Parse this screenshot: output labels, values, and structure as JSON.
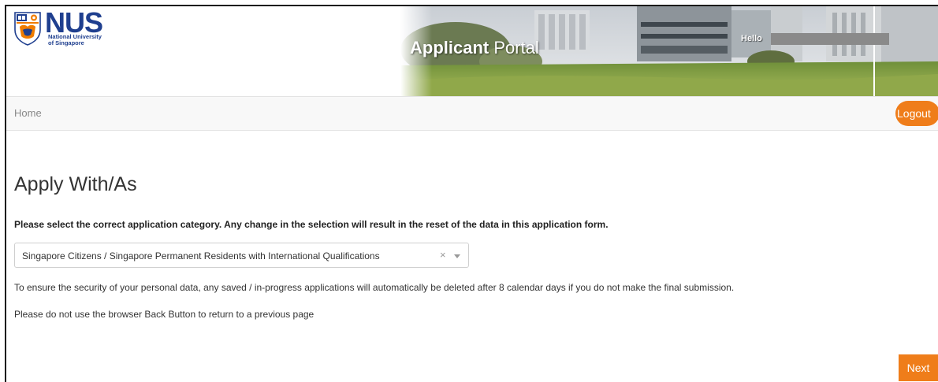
{
  "header": {
    "logo": {
      "name": "NUS",
      "subtitle": "National University\nof Singapore"
    },
    "portal_title_bold": "Applicant",
    "portal_title_light": " Portal",
    "greeting": "Hello"
  },
  "navbar": {
    "home_label": "Home",
    "logout_label": "Logout"
  },
  "main": {
    "title": "Apply With/As",
    "instruction": "Please select the correct application category. Any change in the selection will result in the reset of the data in this application form.",
    "category_select": {
      "selected_value": "Singapore Citizens / Singapore Permanent Residents with International Qualifications",
      "clear_icon": "×"
    },
    "security_note": "To ensure the security of your personal data, any saved / in-progress applications will automatically be deleted after 8 calendar days if you do not make the final submission.",
    "back_note": "Please do not use the browser Back Button to return to a previous page",
    "next_label": "Next"
  },
  "colors": {
    "accent": "#ef7d1a",
    "nus_blue": "#1f3f8f",
    "nus_orange": "#ef7c00"
  }
}
